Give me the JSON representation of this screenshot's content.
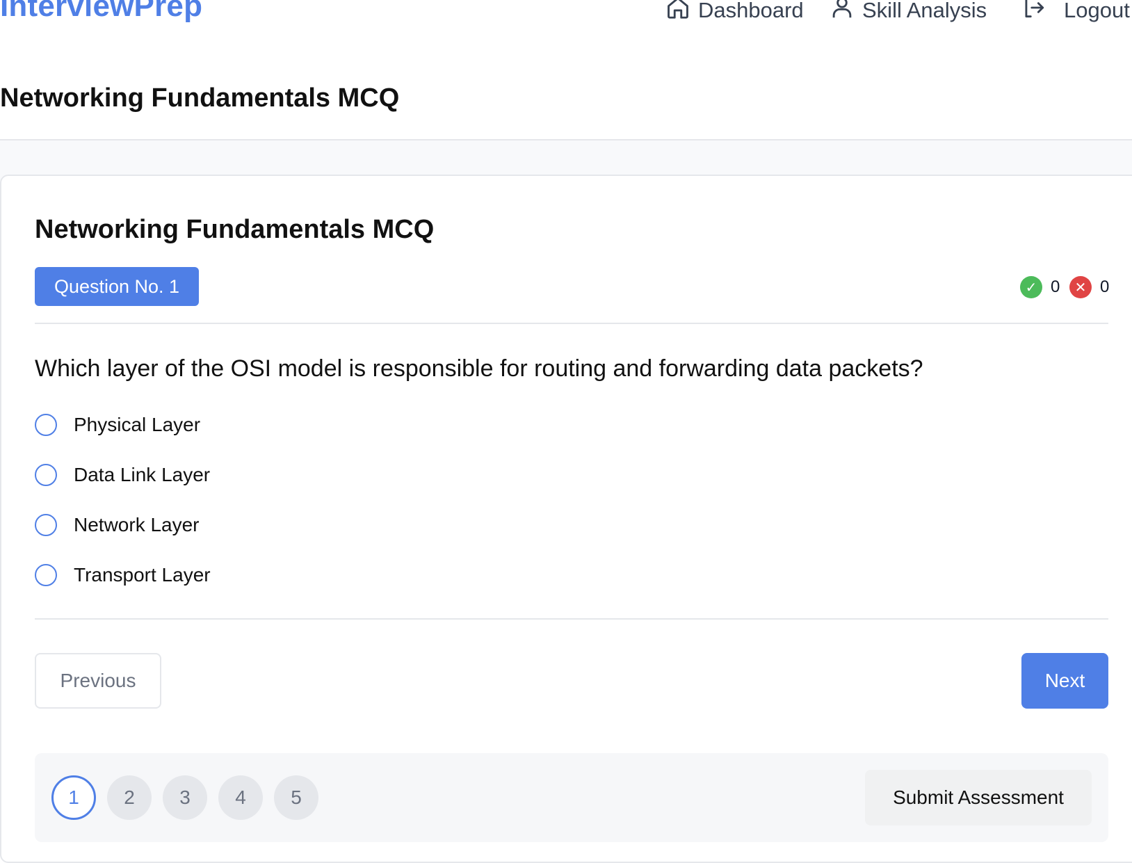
{
  "nav": {
    "brand": "InterviewPrep",
    "dashboard_label": "Dashboard",
    "dashboard_icon": "home-icon",
    "skill_label": "Skill Analysis",
    "skill_icon": "user-icon",
    "logout_label": "Logout",
    "logout_icon": "logout-icon"
  },
  "page": {
    "title": "Networking Fundamentals MCQ"
  },
  "quiz": {
    "title": "Networking Fundamentals MCQ",
    "question_badge": "Question No. 1",
    "correct_count": "0",
    "wrong_count": "0",
    "correct_icon": "✓",
    "wrong_icon": "✕",
    "question": "Which layer of the OSI model is responsible for routing and forwarding data packets?",
    "options": [
      "Physical Layer",
      "Data Link Layer",
      "Network Layer",
      "Transport Layer"
    ],
    "previous_label": "Previous",
    "next_label": "Next",
    "pages": [
      "1",
      "2",
      "3",
      "4",
      "5"
    ],
    "active_page": "1",
    "submit_label": "Submit Assessment"
  },
  "colors": {
    "accent": "#4f7fe6",
    "correct": "#4cbb5a",
    "wrong": "#e04444"
  }
}
